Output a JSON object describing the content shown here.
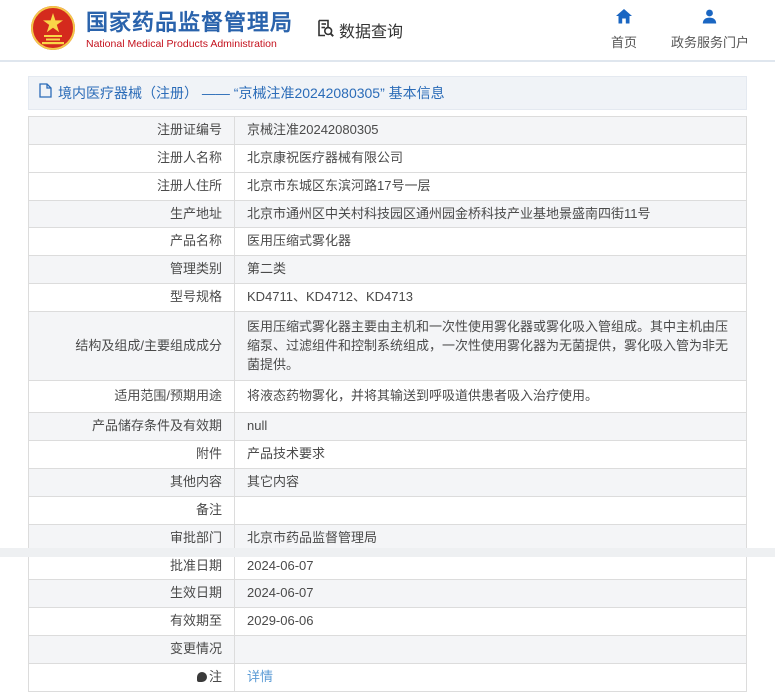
{
  "header": {
    "agency_name_cn": "国家药品监督管理局",
    "agency_name_en": "National Medical Products Administration",
    "data_query_label": "数据查询",
    "nav": [
      {
        "label": "首页"
      },
      {
        "label": "政务服务门户"
      }
    ]
  },
  "page": {
    "title": "境内医疗器械（注册） —— “京械注准20242080305” 基本信息"
  },
  "table": {
    "rows": [
      {
        "label": "注册证编号",
        "value": "京械注准20242080305"
      },
      {
        "label": "注册人名称",
        "value": "北京康祝医疗器械有限公司"
      },
      {
        "label": "注册人住所",
        "value": "北京市东城区东滨河路17号一层"
      },
      {
        "label": "生产地址",
        "value": "北京市通州区中关村科技园区通州园金桥科技产业基地景盛南四街11号"
      },
      {
        "label": "产品名称",
        "value": "医用压缩式雾化器"
      },
      {
        "label": "管理类别",
        "value": "第二类"
      },
      {
        "label": "型号规格",
        "value": "KD4711、KD4712、KD4713"
      },
      {
        "label": "结构及组成/主要组成成分",
        "value": "医用压缩式雾化器主要由主机和一次性使用雾化器或雾化吸入管组成。其中主机由压缩泵、过滤组件和控制系统组成，一次性使用雾化器为无菌提供，雾化吸入管为非无菌提供。"
      },
      {
        "label": "适用范围/预期用途",
        "value": "将液态药物雾化，并将其输送到呼吸道供患者吸入治疗使用。"
      },
      {
        "label": "产品储存条件及有效期",
        "value": "null"
      },
      {
        "label": "附件",
        "value": "产品技术要求"
      },
      {
        "label": "其他内容",
        "value": "其它内容"
      },
      {
        "label": "备注",
        "value": ""
      },
      {
        "label": "审批部门",
        "value": "北京市药品监督管理局"
      },
      {
        "label": "批准日期",
        "value": "2024-06-07"
      },
      {
        "label": "生效日期",
        "value": "2024-06-07"
      },
      {
        "label": "有效期至",
        "value": "2029-06-06"
      },
      {
        "label": "变更情况",
        "value": ""
      },
      {
        "label": "注",
        "value": "详情"
      }
    ]
  }
}
